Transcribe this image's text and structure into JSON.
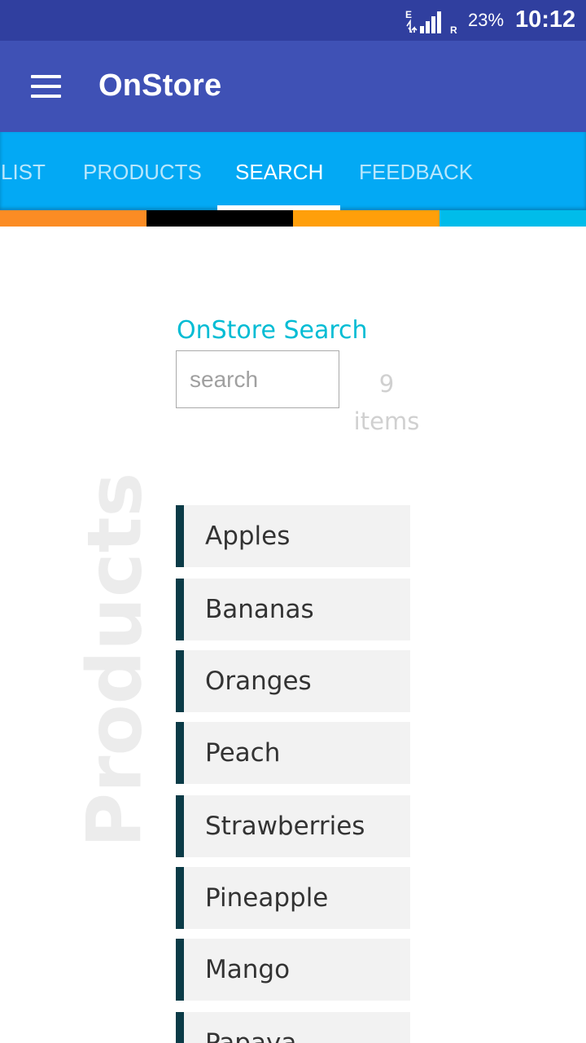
{
  "status_bar": {
    "network": "E",
    "roaming": "R",
    "battery": "23%",
    "time": "10:12"
  },
  "app_bar": {
    "title": "OnStore",
    "menu_icon": "hamburger-menu-icon"
  },
  "tabs": [
    {
      "label": "LIST",
      "active": false
    },
    {
      "label": "PRODUCTS",
      "active": false
    },
    {
      "label": "SEARCH",
      "active": true
    },
    {
      "label": "FEEDBACK",
      "active": false
    }
  ],
  "color_strip": [
    "#fb8c24",
    "#000000",
    "#ff9f0a",
    "#00bcea"
  ],
  "search": {
    "heading": "OnStore Search",
    "placeholder": "search",
    "value": "",
    "count_number": "9",
    "count_label": "items"
  },
  "products_section": {
    "label": "Products",
    "items": [
      "Apples",
      "Bananas",
      "Oranges",
      "Peach",
      "Strawberries",
      "Pineapple",
      "Mango",
      "Papaya"
    ]
  },
  "colors": {
    "status_bar": "#303f9f",
    "app_bar": "#3f51b5",
    "tab_bar": "#03a9f4",
    "accent": "#00bcd4",
    "item_border": "#0b3b47"
  }
}
